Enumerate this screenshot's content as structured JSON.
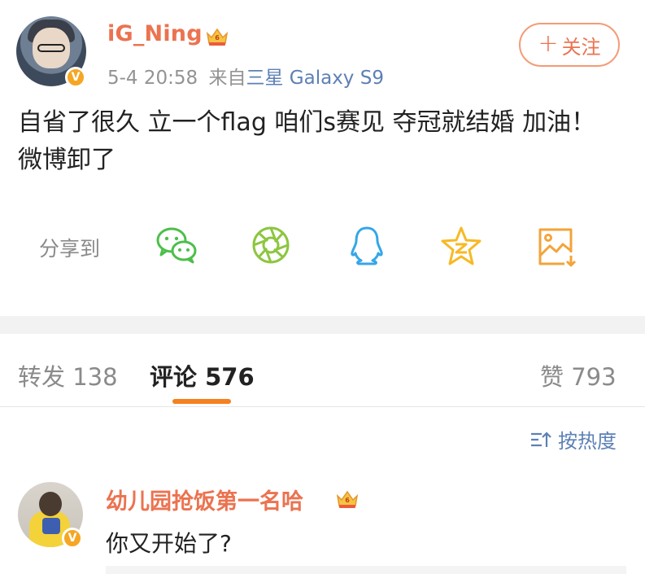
{
  "post": {
    "username": "iG_Ning",
    "time": "5-4 20:58",
    "source_prefix": "来自",
    "device": "三星 Galaxy S9",
    "follow_label": "关注",
    "follow_plus": "+",
    "text": "自省了很久 立一个flag 咱们s赛见 夺冠就结婚 加油！ 微博卸了",
    "verified_glyph": "V"
  },
  "share": {
    "label": "分享到",
    "icons": [
      "wechat-icon",
      "moments-icon",
      "qq-icon",
      "qzone-icon",
      "save-image-icon"
    ]
  },
  "tabs": {
    "repost_label": "转发",
    "repost_count": "138",
    "comment_label": "评论",
    "comment_count": "576",
    "like_label": "赞",
    "like_count": "793"
  },
  "sort": {
    "label": "按热度"
  },
  "comments": [
    {
      "username": "幼儿园抢饭第一名哈",
      "text": "你又开始了?"
    }
  ],
  "colors": {
    "accent": "#eb7350",
    "link": "#5d80b5",
    "tab_underline": "#f5801f"
  }
}
